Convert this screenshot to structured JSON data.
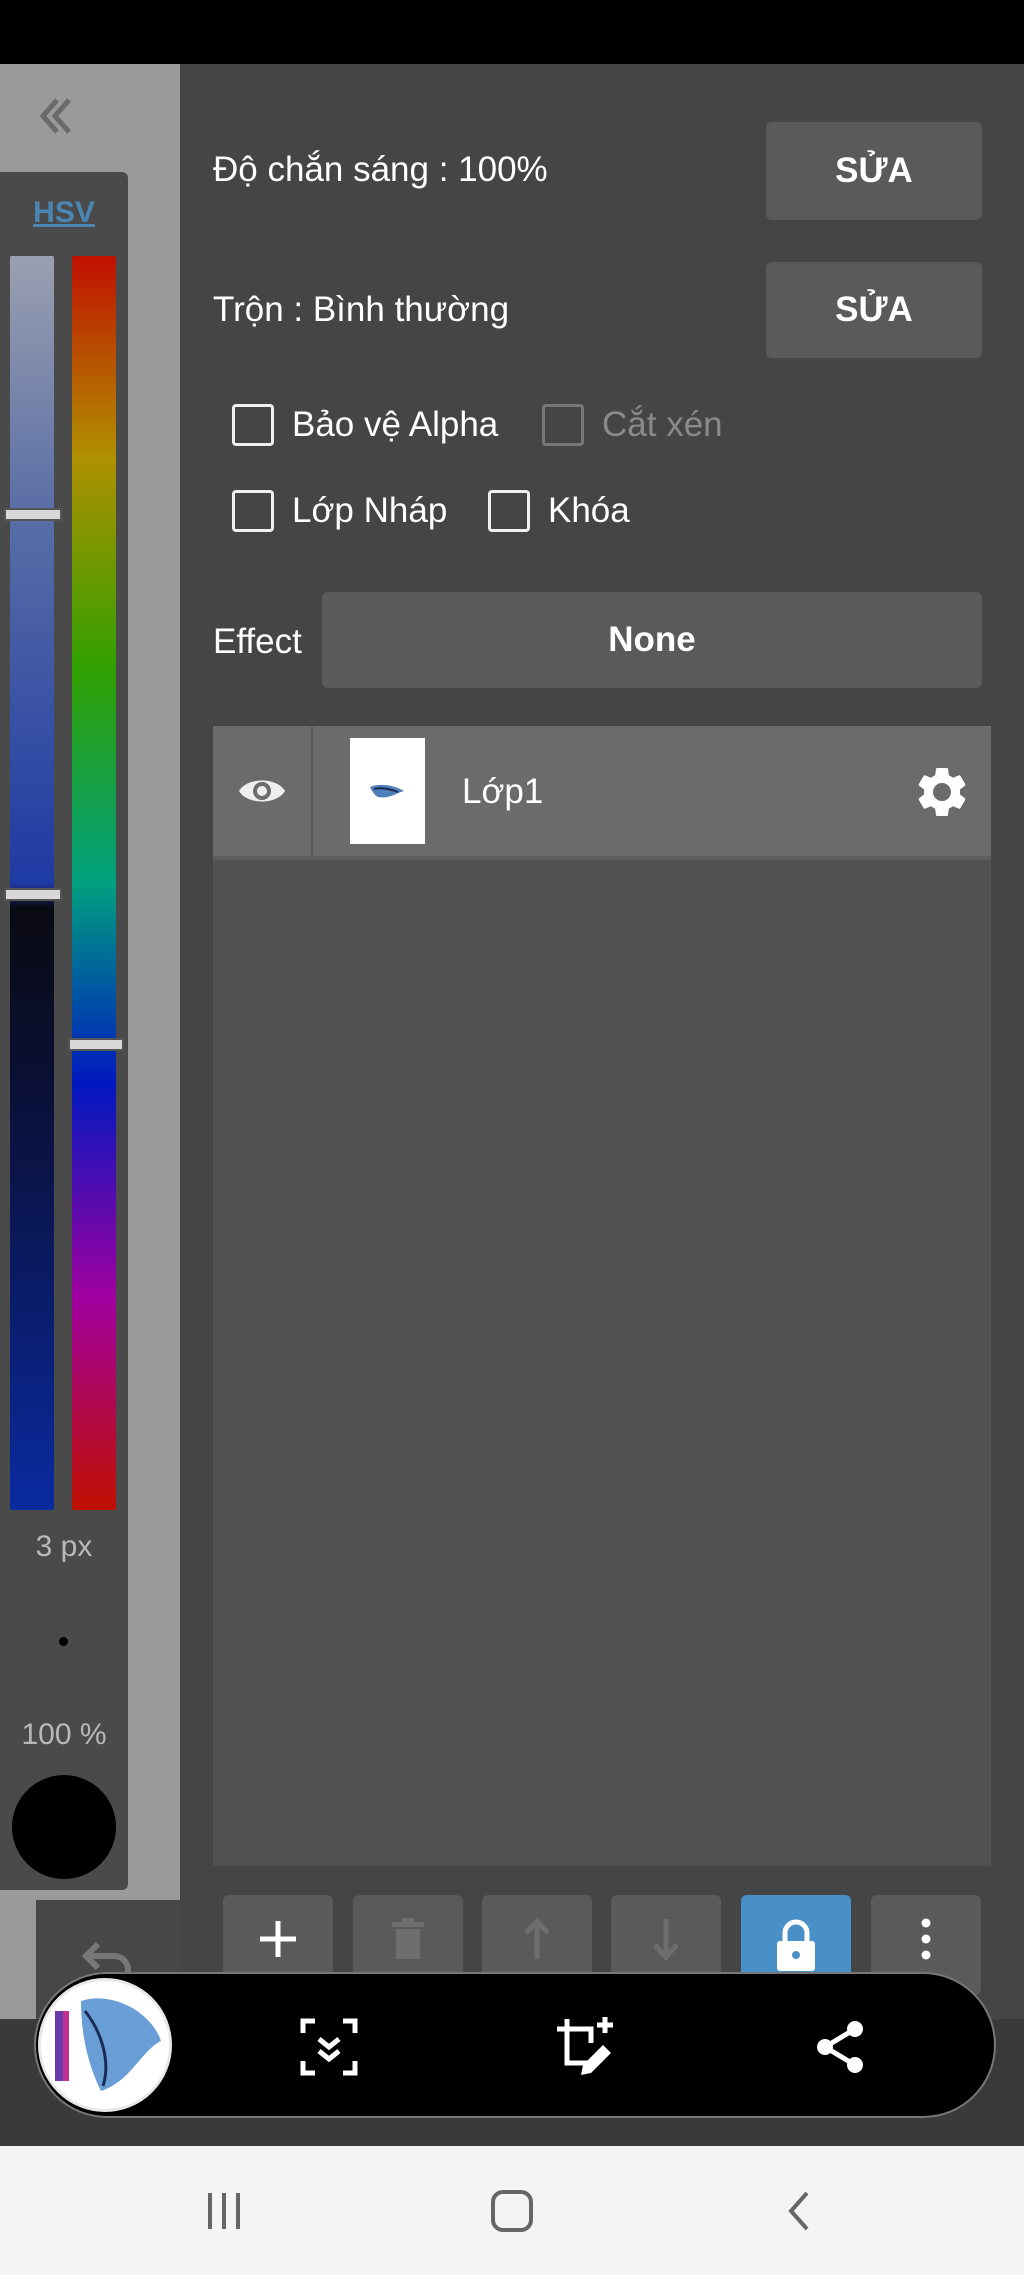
{
  "color_panel": {
    "mode_tab": "HSV",
    "brush_size": "3 px",
    "brush_opacity": "100 %",
    "hue_level": 0.61,
    "saturation_level": 0.2,
    "value_level": 0.5,
    "current_color": "#000000"
  },
  "layer_settings": {
    "opacity_label": "Độ chắn sáng : 100%",
    "opacity_edit": "SỬA",
    "blend_label": "Trộn : Bình thường",
    "blend_edit": "SỬA",
    "alpha_protect": "Bảo vệ Alpha",
    "clipping": "Cắt xén",
    "draft_layer": "Lớp Nháp",
    "lock": "Khóa",
    "effect_label": "Effect",
    "effect_value": "None"
  },
  "layers": [
    {
      "name": "Lớp1",
      "visible": true
    }
  ],
  "layer_toolbar": {
    "lock_active": true,
    "accent": "#4a90c8"
  },
  "capture_toolbar": {
    "icons": [
      "scroll-capture-icon",
      "crop-edit-icon",
      "share-icon"
    ]
  },
  "navigation": {
    "icons": [
      "recent-apps-icon",
      "home-icon",
      "back-icon"
    ]
  }
}
